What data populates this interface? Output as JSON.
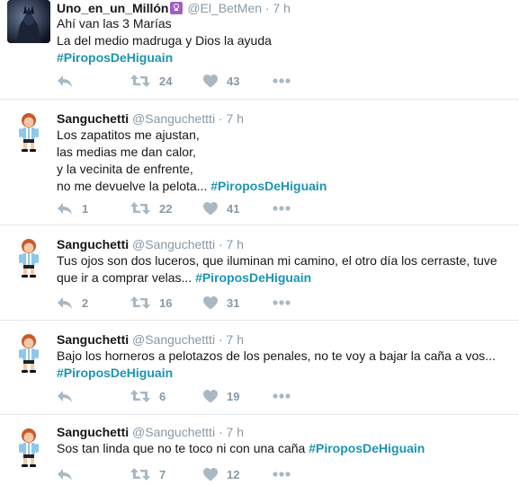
{
  "tweets": [
    {
      "name": "Uno_en_un_Millón",
      "handle": "@El_BetMen",
      "dot": "·",
      "time": "7 h",
      "lines": [
        "Ahí van las 3 Marías",
        "La del medio madruga y Dios la ayuda"
      ],
      "hashtag_line": "",
      "hashtag": "#PiroposDeHiguain",
      "replies": "",
      "retweets": "24",
      "likes": "43"
    },
    {
      "name": "Sanguchetti",
      "handle": "@Sanguchettti",
      "dot": "·",
      "time": "7 h",
      "lines": [
        "Los zapatitos me ajustan,",
        "las medias me dan calor,",
        "y la vecinita de enfrente,"
      ],
      "hashtag_line": "no me devuelve la pelota...",
      "hashtag": "#PiroposDeHiguain",
      "replies": "1",
      "retweets": "22",
      "likes": "41"
    },
    {
      "name": "Sanguchetti",
      "handle": "@Sanguchettti",
      "dot": "·",
      "time": "7 h",
      "lines": [
        "Tus ojos son dos luceros, que iluminan mi camino, el otro día los cerraste, tuve"
      ],
      "hashtag_line": "que ir a comprar velas...",
      "hashtag": "#PiroposDeHiguain",
      "replies": "2",
      "retweets": "16",
      "likes": "31"
    },
    {
      "name": "Sanguchetti",
      "handle": "@Sanguchettti",
      "dot": "·",
      "time": "7 h",
      "lines": [
        "Bajo los horneros a pelotazos de los penales, no te voy a bajar la caña a vos..."
      ],
      "hashtag_line": "",
      "hashtag": "#PiroposDeHiguain",
      "replies": "",
      "retweets": "6",
      "likes": "19"
    },
    {
      "name": "Sanguchetti",
      "handle": "@Sanguchettti",
      "dot": "·",
      "time": "7 h",
      "lines": [],
      "hashtag_line": "Sos tan linda que no te toco ni con una caña",
      "hashtag": "#PiroposDeHiguain",
      "replies": "",
      "retweets": "7",
      "likes": "12"
    }
  ],
  "icons": {
    "reply": "reply-icon",
    "retweet": "retweet-icon",
    "like": "heart-icon",
    "more": "more-icon"
  },
  "colors": {
    "hashtag": "#1b95b0",
    "muted": "#8899a6",
    "icon": "#aab8c2",
    "divider": "#e1e8ed"
  }
}
